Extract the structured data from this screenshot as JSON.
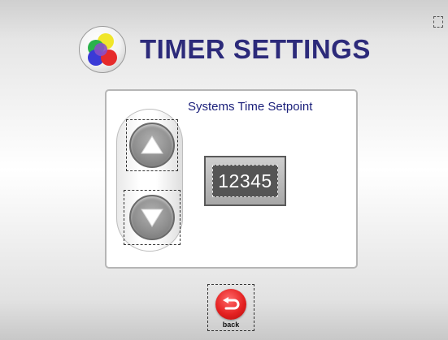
{
  "header": {
    "title": "TIMER SETTINGS",
    "title_color": "#2c2a7a",
    "logo_colors": [
      "#f0e62a",
      "#2bb24c",
      "#3a3ad6",
      "#e62b2b",
      "#8a4fc7"
    ]
  },
  "panel": {
    "label": "Systems Time Setpoint",
    "label_color": "#1a1f7a",
    "display_value": "12345",
    "up_icon": "up-arrow-icon",
    "down_icon": "down-arrow-icon"
  },
  "footer": {
    "back_label": "back",
    "back_icon": "return-arrow-icon",
    "back_color": "#e52222"
  }
}
